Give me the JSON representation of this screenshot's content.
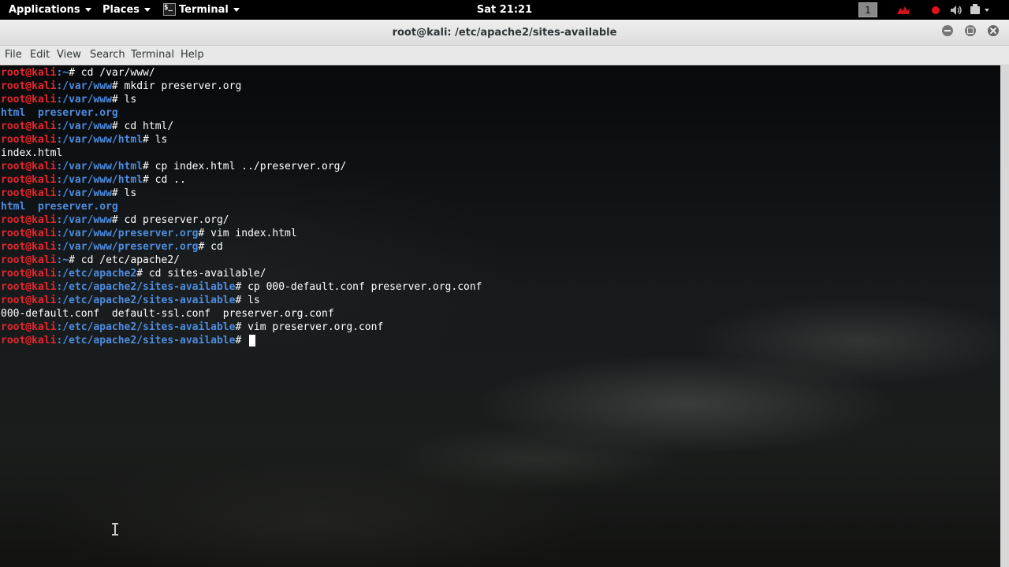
{
  "topbar": {
    "applications": "Applications",
    "places": "Places",
    "terminal": "Terminal",
    "terminal_icon_glyph": "$_",
    "clock": "Sat 21:21",
    "workspace": "1",
    "tray_icons": [
      "kali-dragon-icon",
      "record-icon",
      "volume-icon",
      "power-icon"
    ]
  },
  "window": {
    "title": "root@kali: /etc/apache2/sites-available",
    "menu": {
      "file": "File",
      "edit": "Edit",
      "view": "View",
      "search": "Search",
      "terminal": "Terminal",
      "help": "Help"
    }
  },
  "colors": {
    "user": "#e8262b",
    "path": "#4d8de0",
    "directory_listing": "#4d8de0"
  },
  "terminal": {
    "lines": [
      {
        "type": "prompt",
        "user": "root@kali",
        "path": ":~",
        "cmd": "# cd /var/www/"
      },
      {
        "type": "prompt",
        "user": "root@kali",
        "path": ":/var/www",
        "cmd": "# mkdir preserver.org"
      },
      {
        "type": "prompt",
        "user": "root@kali",
        "path": ":/var/www",
        "cmd": "# ls"
      },
      {
        "type": "dirs",
        "text": "html  preserver.org"
      },
      {
        "type": "prompt",
        "user": "root@kali",
        "path": ":/var/www",
        "cmd": "# cd html/"
      },
      {
        "type": "prompt",
        "user": "root@kali",
        "path": ":/var/www/html",
        "cmd": "# ls"
      },
      {
        "type": "output",
        "text": "index.html"
      },
      {
        "type": "prompt",
        "user": "root@kali",
        "path": ":/var/www/html",
        "cmd": "# cp index.html ../preserver.org/"
      },
      {
        "type": "prompt",
        "user": "root@kali",
        "path": ":/var/www/html",
        "cmd": "# cd .."
      },
      {
        "type": "prompt",
        "user": "root@kali",
        "path": ":/var/www",
        "cmd": "# ls"
      },
      {
        "type": "dirs",
        "text": "html  preserver.org"
      },
      {
        "type": "prompt",
        "user": "root@kali",
        "path": ":/var/www",
        "cmd": "# cd preserver.org/"
      },
      {
        "type": "prompt",
        "user": "root@kali",
        "path": ":/var/www/preserver.org",
        "cmd": "# vim index.html"
      },
      {
        "type": "prompt",
        "user": "root@kali",
        "path": ":/var/www/preserver.org",
        "cmd": "# cd"
      },
      {
        "type": "prompt",
        "user": "root@kali",
        "path": ":~",
        "cmd": "# cd /etc/apache2/"
      },
      {
        "type": "prompt",
        "user": "root@kali",
        "path": ":/etc/apache2",
        "cmd": "# cd sites-available/"
      },
      {
        "type": "prompt",
        "user": "root@kali",
        "path": ":/etc/apache2/sites-available",
        "cmd": "# cp 000-default.conf preserver.org.conf"
      },
      {
        "type": "prompt",
        "user": "root@kali",
        "path": ":/etc/apache2/sites-available",
        "cmd": "# ls"
      },
      {
        "type": "output",
        "text": "000-default.conf  default-ssl.conf  preserver.org.conf"
      },
      {
        "type": "prompt",
        "user": "root@kali",
        "path": ":/etc/apache2/sites-available",
        "cmd": "# vim preserver.org.conf"
      },
      {
        "type": "current",
        "user": "root@kali",
        "path": ":/etc/apache2/sites-available",
        "cmd": "# "
      }
    ]
  }
}
